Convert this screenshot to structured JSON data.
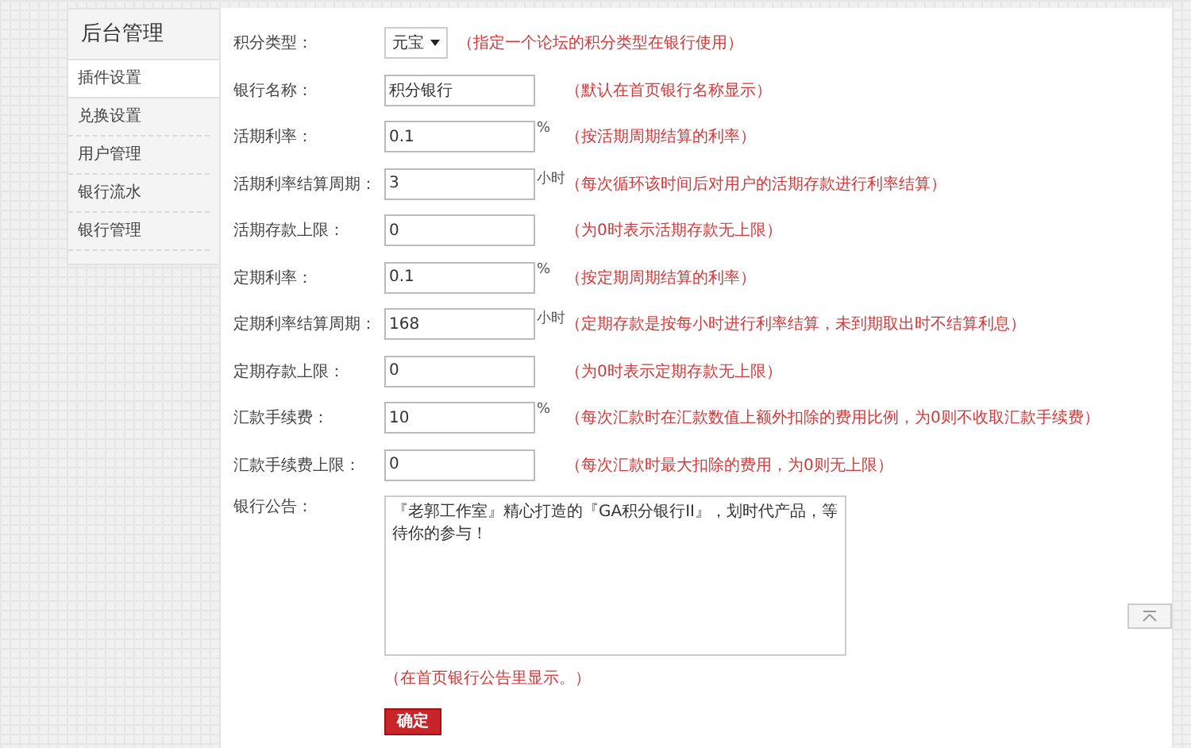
{
  "sidebar": {
    "title": "后台管理",
    "items": [
      {
        "label": "插件设置",
        "selected": true
      },
      {
        "label": "兑换设置",
        "selected": false
      },
      {
        "label": "用户管理",
        "selected": false
      },
      {
        "label": "银行流水",
        "selected": false
      },
      {
        "label": "银行管理",
        "selected": false
      }
    ]
  },
  "form": {
    "fields": [
      {
        "kind": "select",
        "label": "积分类型：",
        "value": "元宝",
        "hint": "（指定一个论坛的积分类型在银行使用）"
      },
      {
        "kind": "input",
        "label": "银行名称：",
        "value": "积分银行",
        "hint": "（默认在首页银行名称显示）"
      },
      {
        "kind": "input",
        "label": "活期利率：",
        "value": "0.1",
        "unit": "%",
        "hint": "（按活期周期结算的利率）"
      },
      {
        "kind": "input",
        "label": "活期利率结算周期：",
        "value": "3",
        "unit": "小时",
        "hint": "（每次循环该时间后对用户的活期存款进行利率结算）"
      },
      {
        "kind": "input",
        "label": "活期存款上限：",
        "value": "0",
        "hint": "（为0时表示活期存款无上限）"
      },
      {
        "kind": "input",
        "label": "定期利率：",
        "value": "0.1",
        "unit": "%",
        "hint": "（按定期周期结算的利率）"
      },
      {
        "kind": "input",
        "label": "定期利率结算周期：",
        "value": "168",
        "unit": "小时",
        "hint": "（定期存款是按每小时进行利率结算，未到期取出时不结算利息）"
      },
      {
        "kind": "input",
        "label": "定期存款上限：",
        "value": "0",
        "hint": "（为0时表示定期存款无上限）"
      },
      {
        "kind": "input",
        "label": "汇款手续费：",
        "value": "10",
        "unit": "%",
        "hint": "（每次汇款时在汇款数值上额外扣除的费用比例，为0则不收取汇款手续费）"
      },
      {
        "kind": "input",
        "label": "汇款手续费上限：",
        "value": "0",
        "hint": "（每次汇款时最大扣除的费用，为0则无上限）"
      },
      {
        "kind": "textarea",
        "label": "银行公告：",
        "value": "『老郭工作室』精心打造的『GA积分银行II』，划时代产品，等待你的参与！",
        "hint": "（在首页银行公告里显示。）"
      }
    ],
    "submit": "确定"
  }
}
